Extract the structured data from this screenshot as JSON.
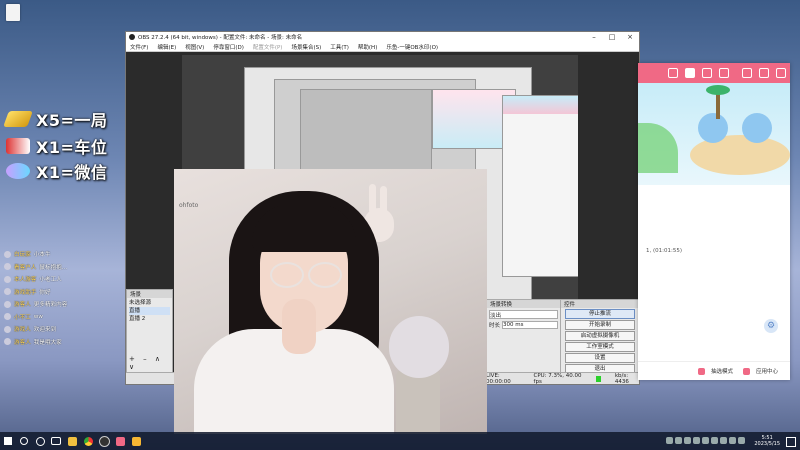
{
  "overlay": {
    "lines": [
      {
        "text": "X5=一局",
        "icon": "gold-bar-icon"
      },
      {
        "text": "X1=车位",
        "icon": "car-icon"
      },
      {
        "text": "X1=微信",
        "icon": "rocket-icon"
      }
    ]
  },
  "chat": [
    {
      "name": "白玩家",
      "msg": "小本牛"
    },
    {
      "name": "看客户人",
      "msg": "鼠标抱抱..."
    },
    {
      "name": "本人游客",
      "msg": "小老工人"
    },
    {
      "name": "游戏助手",
      "msg": "你好"
    },
    {
      "name": "游客人",
      "msg": "更多精彩内容"
    },
    {
      "name": "小不工",
      "msg": "ww"
    },
    {
      "name": "游戏人",
      "msg": "欢迎来到"
    },
    {
      "name": "游客人",
      "msg": "我是哦大家"
    }
  ],
  "obs": {
    "title": "OBS 27.2.4 (64 bit, windows) - 配置文件: 未命名 - 场景: 未命名",
    "menu": [
      "文件(F)",
      "编辑(E)",
      "视图(V)",
      "停靠窗口(D)",
      "配置文件(P)",
      "场景集合(S)",
      "工具(T)",
      "帮助(H)",
      "乐鱼-一键OB水印(O)"
    ],
    "panels": {
      "scenes_title": "场景",
      "scenes": [
        "未选择源",
        "直播",
        "直播 2"
      ],
      "mixer_title": "场景转换",
      "mixer_mode": "淡出",
      "mixer_duration_label": "时长",
      "mixer_duration_value": "300 ms",
      "controls_title": "控件",
      "controls": [
        "停止推流",
        "开始录制",
        "启动虚拟摄像机",
        "工作室模式",
        "设置",
        "退出"
      ]
    },
    "status": {
      "live": "LIVE: 00:00:00",
      "cpu": "CPU: 7.3%, 40.00 fps",
      "kbps": "kb/s: 4436"
    }
  },
  "pink_app": {
    "timestamp": "1, (01:01:55)",
    "bottom_items": [
      "抽选模式",
      "应用中心"
    ]
  },
  "taskbar": {
    "time": "5:51",
    "date": "2023/5/15"
  }
}
